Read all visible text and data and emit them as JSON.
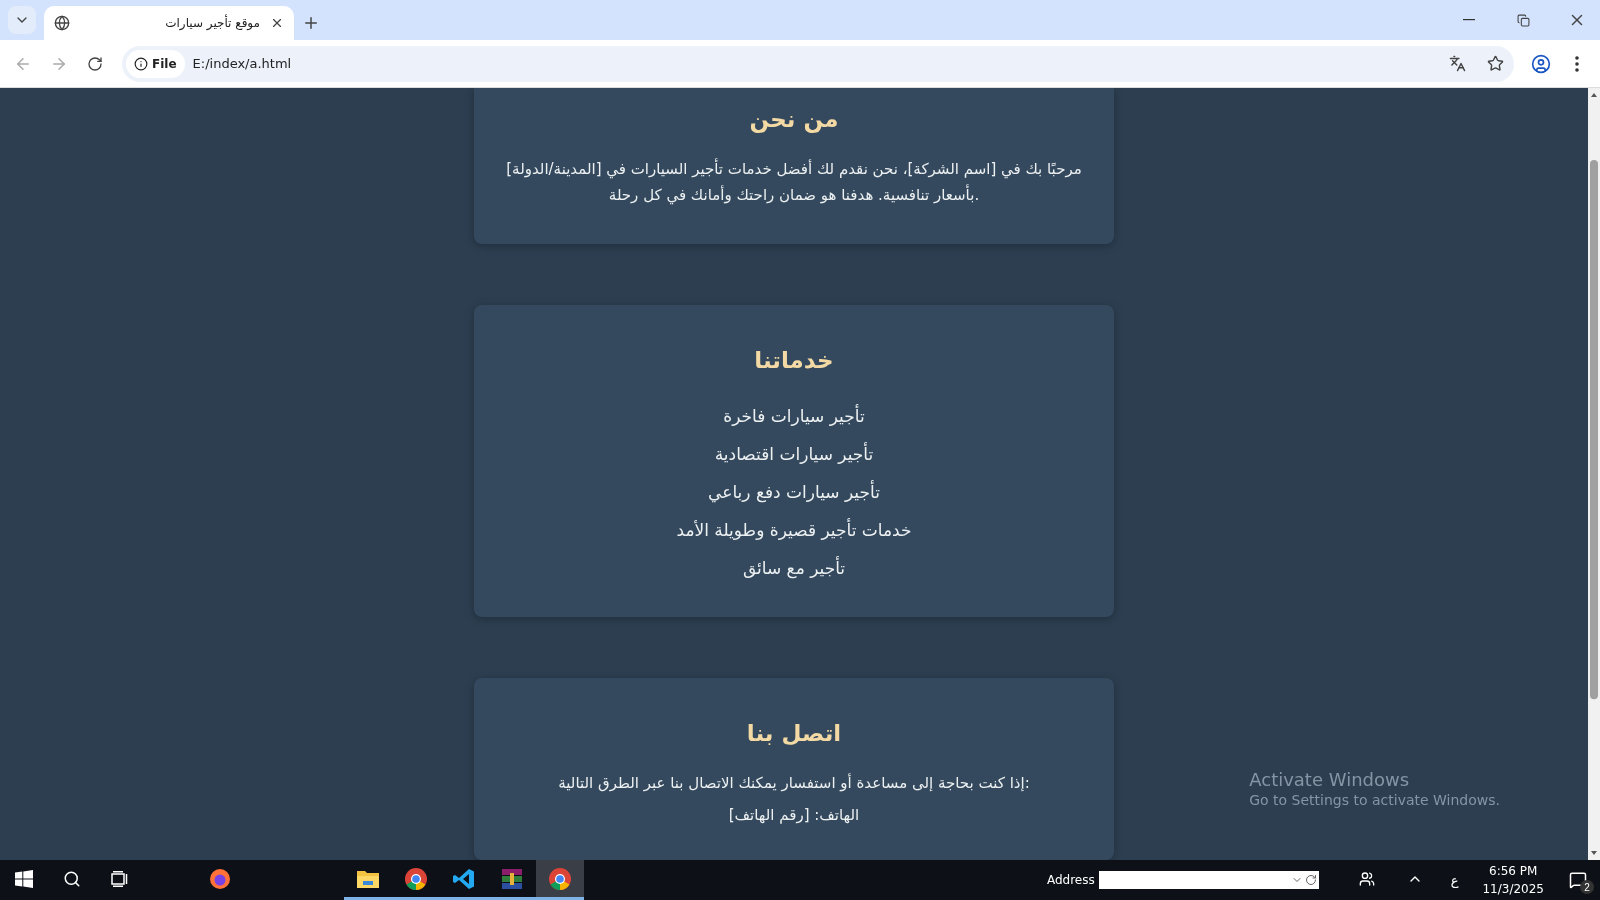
{
  "browser": {
    "tab_title": "موقع تأجير سيارات",
    "site_chip": "File",
    "url": "E:/index/a.html"
  },
  "sections": [
    {
      "kind": "text",
      "title": "من نحن",
      "body": "مرحبًا بك في [اسم الشركة]، نحن نقدم لك أفضل خدمات تأجير السيارات في [المدينة/الدولة] بأسعار تنافسية. هدفنا هو ضمان راحتك وأمانك في كل رحلة."
    },
    {
      "kind": "list",
      "title": "خدماتنا",
      "items": [
        "تأجير سيارات فاخرة",
        "تأجير سيارات اقتصادية",
        "تأجير سيارات دفع رباعي",
        "خدمات تأجير قصيرة وطويلة الأمد",
        "تأجير مع سائق"
      ]
    },
    {
      "kind": "contact",
      "title": "اتصل بنا",
      "body": "إذا كنت بحاجة إلى مساعدة أو استفسار يمكنك الاتصال بنا عبر الطرق التالية:",
      "items": [
        "الهاتف: [رقم الهاتف]"
      ]
    }
  ],
  "activation": {
    "title": "Activate Windows",
    "subtitle": "Go to Settings to activate Windows."
  },
  "taskbar": {
    "apps": [
      {
        "kind": "firefox",
        "running": false,
        "selected": false
      },
      {
        "kind": "folder",
        "running": true,
        "selected": false
      },
      {
        "kind": "chrome",
        "running": true,
        "selected": false
      },
      {
        "kind": "vscode",
        "running": true,
        "selected": false
      },
      {
        "kind": "archive",
        "running": true,
        "selected": false
      },
      {
        "kind": "chrome",
        "running": true,
        "selected": true
      }
    ],
    "address_label": "Address",
    "input_indicator": "ع",
    "time": "6:56 PM",
    "date": "11/3/2025",
    "notifications": "2"
  }
}
